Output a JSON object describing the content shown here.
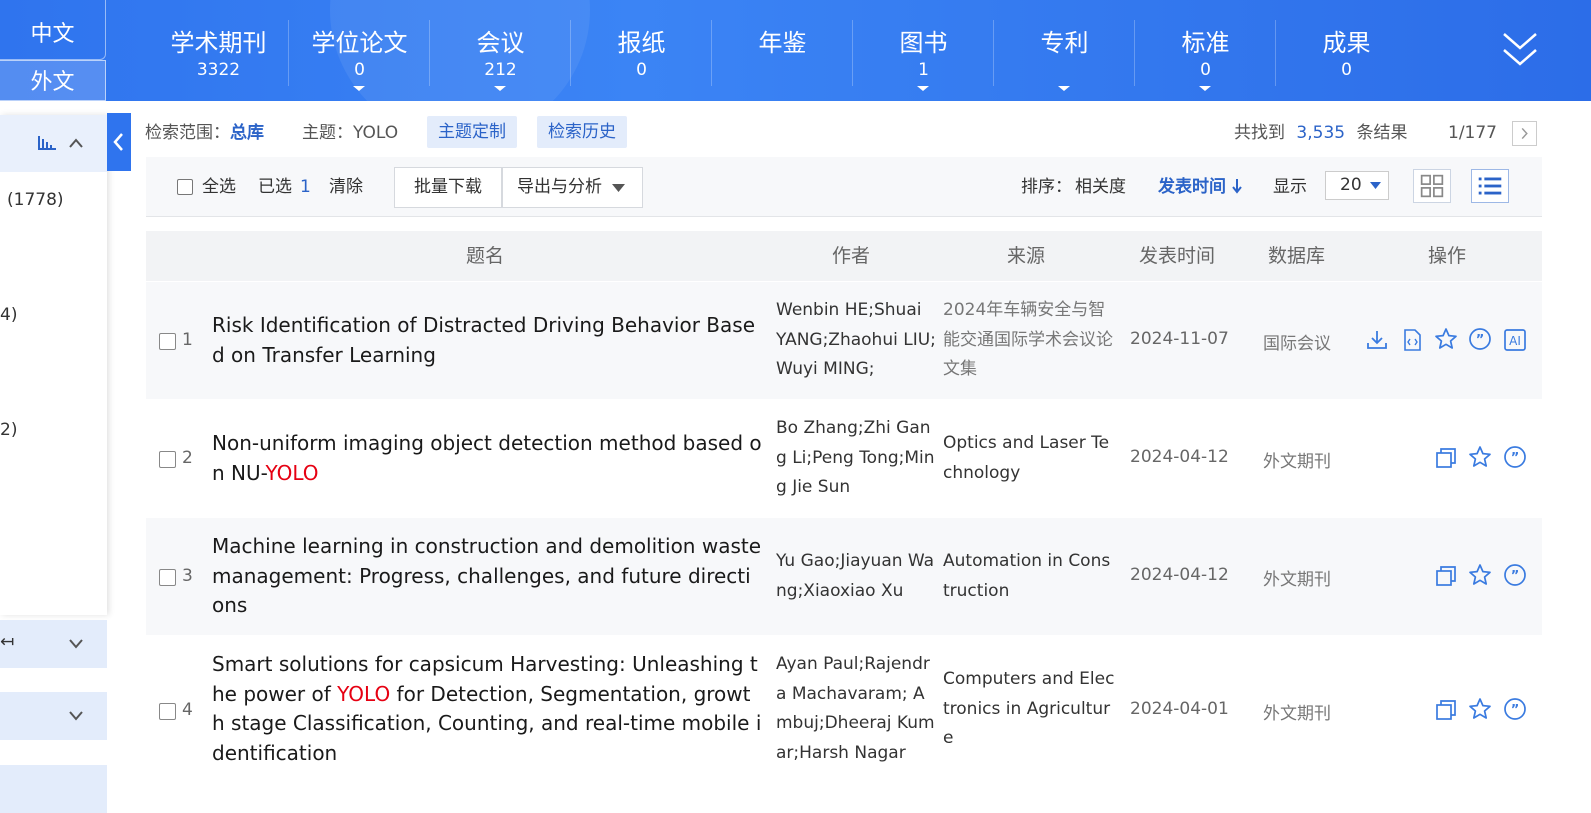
{
  "lang": {
    "zh": "中文",
    "foreign": "外文"
  },
  "nav": [
    {
      "label": "学术期刊",
      "count": "3322"
    },
    {
      "label": "学位论文",
      "count": "0"
    },
    {
      "label": "会议",
      "count": "212"
    },
    {
      "label": "报纸",
      "count": "0"
    },
    {
      "label": "年鉴",
      "count": ""
    },
    {
      "label": "图书",
      "count": "1"
    },
    {
      "label": "专利",
      "count": ""
    },
    {
      "label": "标准",
      "count": "0"
    },
    {
      "label": "成果",
      "count": "0"
    }
  ],
  "sidebar": {
    "items": [
      "(1778)",
      "4)",
      "2)"
    ],
    "section1_label": "↤"
  },
  "search": {
    "scope_label": "检索范围：",
    "scope_value": "总库",
    "topic_label": "主题：",
    "topic_value": "YOLO",
    "custom_topic": "主题定制",
    "history": "检索历史",
    "found_prefix": "共找到",
    "found_count": "3,535",
    "found_suffix": "条结果",
    "page": "1/177"
  },
  "toolbar": {
    "select_all": "全选",
    "selected_label": "已选",
    "selected_count": "1",
    "clear": "清除",
    "batch_download": "批量下载",
    "export": "导出与分析",
    "sort_label": "排序：",
    "sort_relevance": "相关度",
    "sort_date": "发表时间",
    "display_label": "显示",
    "page_size": "20"
  },
  "table": {
    "headers": {
      "title": "题名",
      "author": "作者",
      "source": "来源",
      "date": "发表时间",
      "db": "数据库",
      "ops": "操作"
    },
    "rows": [
      {
        "num": "1",
        "title_pre": "Risk Identification of Distracted Driving Behavior Based on Transfer Learning",
        "title_hl": "",
        "title_post": "",
        "author": "Wenbin HE;Shuai YANG;Zhaohui LIU;Wuyi MING;",
        "source": "2024年车辆安全与智能交通国际学术会议论文集",
        "date": "2024-11-07",
        "db": "国际会议"
      },
      {
        "num": "2",
        "title_pre": "Non-uniform imaging object detection method based on NU-",
        "title_hl": "YOLO",
        "title_post": "",
        "author": "Bo Zhang;Zhi Gang Li;Peng Tong;Ming Jie Sun",
        "source": "Optics and Laser Technology",
        "date": "2024-04-12",
        "db": "外文期刊"
      },
      {
        "num": "3",
        "title_pre": "Machine learning in construction and demolition waste management: Progress, challenges, and future directions",
        "title_hl": "",
        "title_post": "",
        "author": "Yu Gao;Jiayuan Wang;Xiaoxiao Xu",
        "source": "Automation in Construction",
        "date": "2024-04-12",
        "db": "外文期刊"
      },
      {
        "num": "4",
        "title_pre": "Smart solutions for capsicum Harvesting: Unleashing the power of ",
        "title_hl": "YOLO",
        "title_post": " for Detection, Segmentation, growth stage Classification, Counting, and real-time mobile identification",
        "author": "Ayan Paul;Rajendra Machavaram; Ambuj;Dheeraj Kumar;Harsh Nagar",
        "source": "Computers and Electronics in Agriculture",
        "date": "2024-04-01",
        "db": "外文期刊"
      }
    ]
  },
  "colors": {
    "brand": "#2f74ee",
    "link": "#2b63c8",
    "highlight": "#e60012"
  },
  "icons": [
    "download-icon",
    "html-icon",
    "favorite-icon",
    "cite-icon",
    "ai-icon",
    "copy-icon",
    "chevron-down-icon",
    "chevron-up-icon",
    "bar-chart-icon",
    "grid-view-icon",
    "list-view-icon"
  ]
}
